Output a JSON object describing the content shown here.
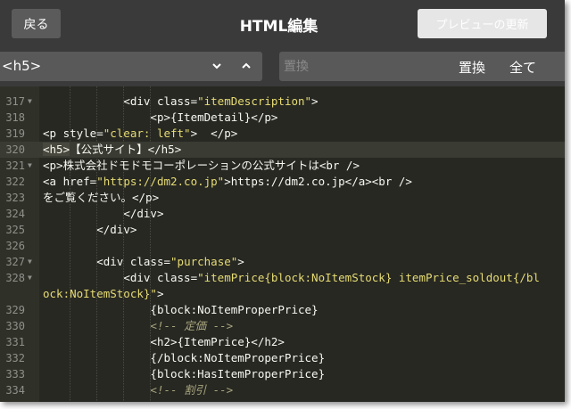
{
  "header": {
    "back_label": "戻る",
    "title": "HTML編集",
    "preview_label": "プレビューの更新"
  },
  "search": {
    "value": "<h5>",
    "replace_placeholder": "置換",
    "replace_label": "置換",
    "replace_all_label": "全て"
  },
  "editor": {
    "lines": [
      {
        "n": "317",
        "fold": true,
        "indent": "            ",
        "parts": [
          [
            "t",
            "<div class="
          ],
          [
            "s",
            "\"itemDescription\""
          ],
          [
            "t",
            ">"
          ]
        ]
      },
      {
        "n": "318",
        "fold": false,
        "indent": "                ",
        "parts": [
          [
            "t",
            "<p>{ItemDetail}</p>"
          ]
        ]
      },
      {
        "n": "319",
        "fold": false,
        "indent": "",
        "parts": [
          [
            "t",
            "<p style="
          ],
          [
            "s",
            "\"clear: left\""
          ],
          [
            "t",
            ">  </p>"
          ]
        ]
      },
      {
        "n": "320",
        "fold": false,
        "indent": "",
        "parts": [
          [
            "sel",
            "<h5>"
          ],
          [
            "t",
            "【公式サイト】</h5>"
          ]
        ]
      },
      {
        "n": "321",
        "fold": true,
        "indent": "",
        "parts": [
          [
            "t",
            "<p>株式会社ドモドモコーポレーションの公式サイトは<br />"
          ]
        ]
      },
      {
        "n": "322",
        "fold": false,
        "indent": "",
        "parts": [
          [
            "t",
            "<a href="
          ],
          [
            "s",
            "\"https://dm2.co.jp\""
          ],
          [
            "t",
            ">https://dm2.co.jp</a><br />"
          ]
        ]
      },
      {
        "n": "323",
        "fold": false,
        "indent": "",
        "parts": [
          [
            "t",
            "をご覧ください。</p>"
          ]
        ]
      },
      {
        "n": "324",
        "fold": false,
        "indent": "            ",
        "parts": [
          [
            "t",
            "</div>"
          ]
        ]
      },
      {
        "n": "325",
        "fold": false,
        "indent": "        ",
        "parts": [
          [
            "t",
            "</div>"
          ]
        ]
      },
      {
        "n": "326",
        "fold": false,
        "indent": "",
        "parts": []
      },
      {
        "n": "327",
        "fold": true,
        "indent": "        ",
        "parts": [
          [
            "t",
            "<div class="
          ],
          [
            "s",
            "\"purchase\""
          ],
          [
            "t",
            ">"
          ]
        ]
      },
      {
        "n": "328",
        "fold": true,
        "indent": "            ",
        "parts": [
          [
            "t",
            "<div class="
          ],
          [
            "s",
            "\"itemPrice{block:NoItemStock} itemPrice_soldout{/block:NoItemStock}\""
          ],
          [
            "t",
            ">"
          ]
        ]
      },
      {
        "n": "329",
        "fold": false,
        "indent": "                ",
        "parts": [
          [
            "t",
            "{block:NoItemProperPrice}"
          ]
        ]
      },
      {
        "n": "330",
        "fold": false,
        "indent": "                ",
        "parts": [
          [
            "c",
            "<!-- 定価 -->"
          ]
        ]
      },
      {
        "n": "331",
        "fold": false,
        "indent": "                ",
        "parts": [
          [
            "t",
            "<h2>{ItemPrice}</h2>"
          ]
        ]
      },
      {
        "n": "332",
        "fold": false,
        "indent": "                ",
        "parts": [
          [
            "t",
            "{/block:NoItemProperPrice}"
          ]
        ]
      },
      {
        "n": "333",
        "fold": false,
        "indent": "                ",
        "parts": [
          [
            "t",
            "{block:HasItemProperPrice}"
          ]
        ]
      },
      {
        "n": "334",
        "fold": false,
        "indent": "                ",
        "parts": [
          [
            "c",
            "<!-- 割引 -->"
          ]
        ]
      }
    ]
  }
}
